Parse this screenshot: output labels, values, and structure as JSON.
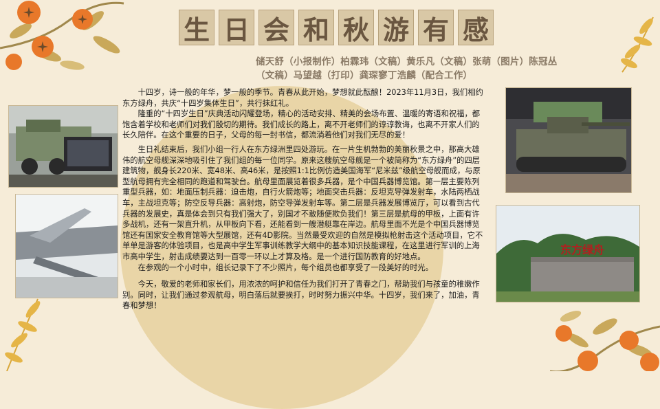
{
  "title_chars": [
    "生",
    "日",
    "会",
    "和",
    "秋",
    "游",
    "有",
    "感"
  ],
  "credits": "储天舒（小报制作）柏霖玮（文稿）黄乐凡（文稿）张萌（图片）陈冠丛（文稿）马望越（打印）龚琛寥丁浩麟（配合工作）",
  "paragraphs": [
    "十四岁，诗一般的年华，梦一般的季节。青春从此开始，梦想就此酝酿！2023年11月3日，我们相约东方绿舟，共庆“十四岁集体生日”，共行抹红礼。",
    "隆重的“十四岁生日”庆典活动闪耀登场，精心的活动安排、精美的会场布置、温暖的寄语和祝福，都饱含着学校和老师们对我们殷切的期待。我们成长的路上，离不开老师们的谆谆教诲，也离不开家人们的长久陪伴。在这个重要的日子，父母的每一封书信，都流淌着他们对我们无尽的爱！",
    "生日礼结束后，我们小组一行人在东方绿洲里四处游玩。在一片生机勃勃的美丽秋景之中，那高大雄伟的航空母舰深深地吸引住了我们组的每一位同学。原来这艘航空母舰是一个被简称为“东方绿舟”的四层建筑物，舰身长220米、宽48米、高46米，是按照1:1比例仿造美国海军“尼米兹”级航空母舰而成，与原型航母拥有完全相同的跑道和驾驶台。航母里面展览着很多兵器，是个中国兵器博览馆。第一层主要陈列重型兵器，如：地面压制兵器：迫击炮，自行火箭炮等；地面突击兵器：反坦克导弹发射车，水陆两栖战车，主战坦克等；防空反导兵器：高射炮，防空导弹发射车等。第二层是兵器发展博览厅，可以看到古代兵器的发展史，真是体会到只有我们强大了，别国才不敢随便欺负我们！第三层是航母的甲板，上面有许多战机，还有一架直升机，从甲板向下看，还能看到一艘潜艇靠在岸边。航母里面不光是个中国兵器博览馆还有国家安全教育馆等大型展馆，还有4D影院。当然最受欢迎的自然是模拟枪射击这个活动项目，它不单单是游客的体验项目，也是高中学生军事训练教学大纲中的基本知识技能课程，在这里进行军训的上海市高中学生，射击成绩要达到一百零一环以上才算及格。是一个进行国防教育的好地点。",
    "在参观的一个小时中，组长记录下了不少照片，每个组员也都享受了一段美好的时光。",
    "今天，敬爱的老师和家长们，用浓浓的呵护和信任为我们打开了青春之门，帮助我们与孩童的稚嫩作别。同时，让我们通过参观航母，明白落后就要挨打，时时努力振兴中华。十四岁，我们来了，加油，青春和梦想！"
  ],
  "photo_sign_text": "东方绿舟",
  "colors": {
    "background": "#f6ecd8",
    "circle": "#e6cf9b",
    "orange": "#e8782a",
    "leaf": "#a0884c",
    "title_text": "#6a5640",
    "credits_text": "#8a7a66"
  }
}
